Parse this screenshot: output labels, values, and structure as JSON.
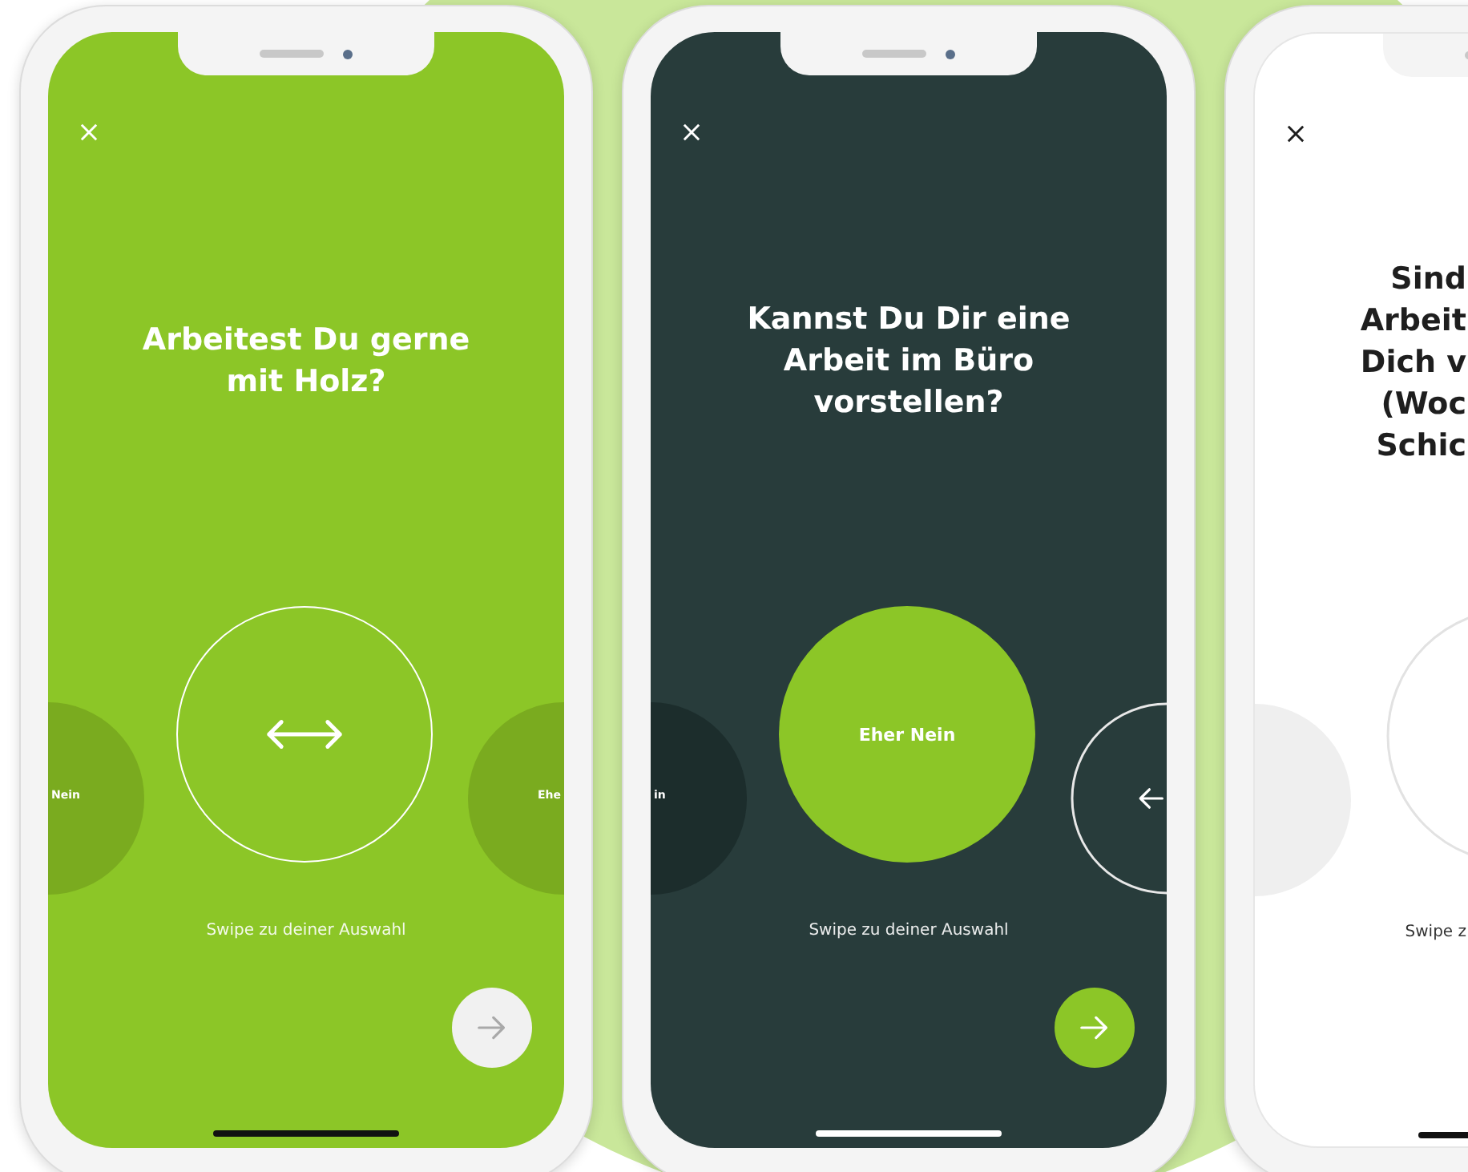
{
  "phones": [
    {
      "kind": "green",
      "lines": [
        "Arbeitest Du gerne",
        "mit Holz?"
      ],
      "left_option": {
        "kind": "label",
        "label": "Nein"
      },
      "center_option": {
        "kind": "arrows"
      },
      "right_option": {
        "kind": "label",
        "label": "Ehe"
      },
      "hint": "Swipe zu deiner Auswahl",
      "next_button": {
        "enabled": false
      }
    },
    {
      "kind": "dark",
      "lines": [
        "Kannst Du Dir eine",
        "Arbeit im Büro",
        "vorstellen?"
      ],
      "left_option": {
        "kind": "label",
        "label": "in"
      },
      "center_option": {
        "kind": "label",
        "label": "Eher Nein"
      },
      "right_option": {
        "kind": "arrow"
      },
      "hint": "Swipe zu deiner Auswahl",
      "next_button": {
        "enabled": true
      }
    },
    {
      "kind": "light",
      "lines": [
        "Sind",
        "Arbeit",
        "Dich v",
        "(Woc",
        "Schic"
      ],
      "left_option": {
        "kind": "blank"
      },
      "center_option": {
        "kind": "blank"
      },
      "hint": "Swipe z"
    }
  ]
}
